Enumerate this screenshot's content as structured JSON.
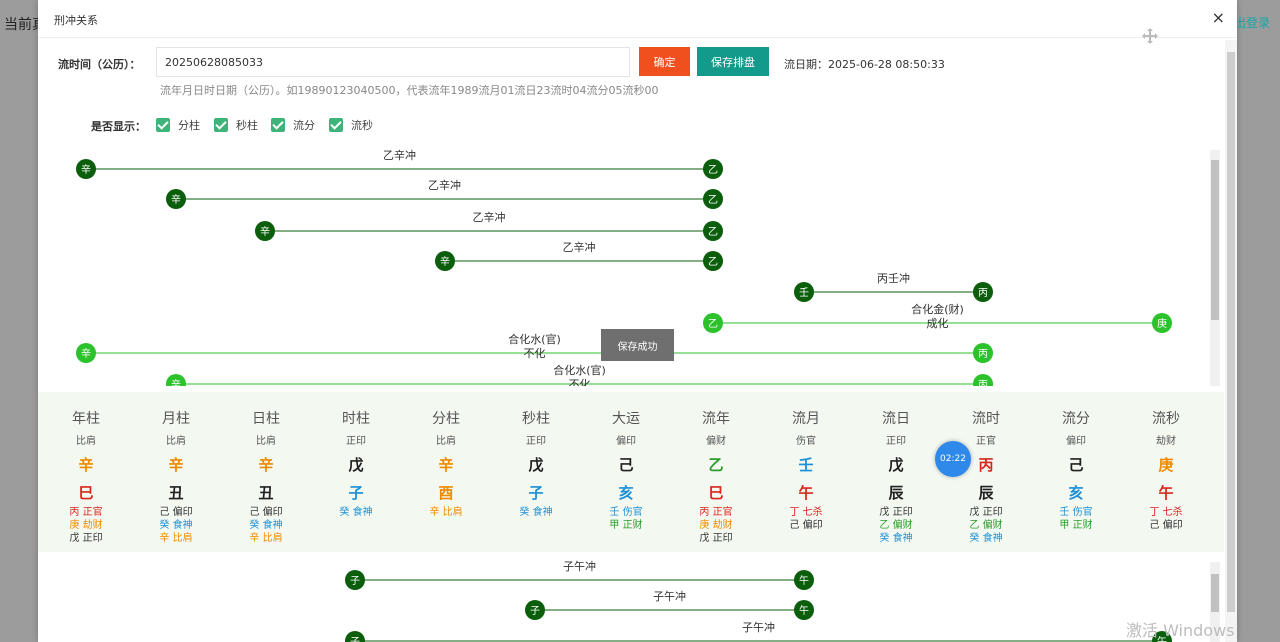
{
  "backdrop": {
    "left_text": "当前真",
    "right_text": "出登录"
  },
  "modal": {
    "title": "刑冲关系",
    "close": "×"
  },
  "form": {
    "liushi_label": "流时间（公历）：",
    "liushi_value": "20250628085033",
    "confirm_label": "确定",
    "save_label": "保存排盘",
    "liu_date": "流日期：2025-06-28 08:50:33",
    "hint": "流年月日时日期（公历）。如19890123040500，代表流年1989流月01流日23流时04流分05流秒00"
  },
  "display": {
    "label": "是否显示：",
    "options": [
      {
        "label": "分柱",
        "checked": true
      },
      {
        "label": "秒柱",
        "checked": true
      },
      {
        "label": "流分",
        "checked": true
      },
      {
        "label": "流秒",
        "checked": true
      }
    ]
  },
  "relations": [
    {
      "from": "辛",
      "to": "乙",
      "label": "乙辛冲",
      "color": "#0b5e0b"
    },
    {
      "from": "辛",
      "to": "乙",
      "label": "乙辛冲",
      "color": "#0b5e0b"
    },
    {
      "from": "辛",
      "to": "乙",
      "label": "乙辛冲",
      "color": "#0b5e0b"
    },
    {
      "from": "辛",
      "to": "乙",
      "label": "乙辛冲",
      "color": "#0b5e0b"
    },
    {
      "from": "壬",
      "to": "丙",
      "label": "丙壬冲",
      "color": "#0b5e0b"
    },
    {
      "from": "乙",
      "to": "庚",
      "label": "合化金(财)成化",
      "color": "#2bc22b"
    },
    {
      "from": "辛",
      "to": "丙",
      "label": "合化水(官)不化",
      "color": "#2bc22b"
    },
    {
      "from": "辛",
      "to": "丙",
      "label": "合化水(官)不化",
      "color": "#2bc22b"
    }
  ],
  "relations_bottom": [
    {
      "from": "子",
      "to": "午",
      "label": "子午冲",
      "color": "#0b5e0b"
    },
    {
      "from": "子",
      "to": "午",
      "label": "子午冲",
      "color": "#0b5e0b"
    },
    {
      "from": "子",
      "to": "午",
      "label": "子午冲",
      "color": "#0b5e0b"
    }
  ],
  "toast": "保存成功",
  "timer": "02:22",
  "pillars": [
    {
      "name": "年柱",
      "ten": "比肩",
      "stem": "辛",
      "stem_color": "#f08a00",
      "branch": "巳",
      "branch_color": "#d9261c",
      "hidden": [
        {
          "text": "丙  正官",
          "color": "#d9261c"
        },
        {
          "text": "庚  劫财",
          "color": "#f08a00"
        },
        {
          "text": "戊  正印",
          "color": "#333333"
        }
      ]
    },
    {
      "name": "月柱",
      "ten": "比肩",
      "stem": "辛",
      "stem_color": "#f08a00",
      "branch": "丑",
      "branch_color": "#222222",
      "hidden": [
        {
          "text": "己  偏印",
          "color": "#333333"
        },
        {
          "text": "癸  食神",
          "color": "#1e8fd6"
        },
        {
          "text": "辛  比肩",
          "color": "#f08a00"
        }
      ]
    },
    {
      "name": "日柱",
      "ten": "比肩",
      "stem": "辛",
      "stem_color": "#f08a00",
      "branch": "丑",
      "branch_color": "#222222",
      "hidden": [
        {
          "text": "己  偏印",
          "color": "#333333"
        },
        {
          "text": "癸  食神",
          "color": "#1e8fd6"
        },
        {
          "text": "辛  比肩",
          "color": "#f08a00"
        }
      ]
    },
    {
      "name": "时柱",
      "ten": "正印",
      "stem": "戊",
      "stem_color": "#222222",
      "branch": "子",
      "branch_color": "#1e8fd6",
      "hidden": [
        {
          "text": "癸  食神",
          "color": "#1e8fd6"
        }
      ]
    },
    {
      "name": "分柱",
      "ten": "比肩",
      "stem": "辛",
      "stem_color": "#f08a00",
      "branch": "酉",
      "branch_color": "#f08a00",
      "hidden": [
        {
          "text": "辛  比肩",
          "color": "#f08a00"
        }
      ]
    },
    {
      "name": "秒柱",
      "ten": "正印",
      "stem": "戊",
      "stem_color": "#222222",
      "branch": "子",
      "branch_color": "#1e8fd6",
      "hidden": [
        {
          "text": "癸  食神",
          "color": "#1e8fd6"
        }
      ]
    },
    {
      "name": "大运",
      "ten": "偏印",
      "stem": "己",
      "stem_color": "#222222",
      "branch": "亥",
      "branch_color": "#1e8fd6",
      "hidden": [
        {
          "text": "壬  伤官",
          "color": "#1e8fd6"
        },
        {
          "text": "甲  正财",
          "color": "#2c9c2c"
        }
      ]
    },
    {
      "name": "流年",
      "ten": "偏财",
      "stem": "乙",
      "stem_color": "#2c9c2c",
      "branch": "巳",
      "branch_color": "#d9261c",
      "hidden": [
        {
          "text": "丙  正官",
          "color": "#d9261c"
        },
        {
          "text": "庚  劫财",
          "color": "#f08a00"
        },
        {
          "text": "戊  正印",
          "color": "#333333"
        }
      ]
    },
    {
      "name": "流月",
      "ten": "伤官",
      "stem": "壬",
      "stem_color": "#1e8fd6",
      "branch": "午",
      "branch_color": "#d9261c",
      "hidden": [
        {
          "text": "丁  七杀",
          "color": "#d9261c"
        },
        {
          "text": "己  偏印",
          "color": "#333333"
        }
      ]
    },
    {
      "name": "流日",
      "ten": "正印",
      "stem": "戊",
      "stem_color": "#222222",
      "branch": "辰",
      "branch_color": "#222222",
      "hidden": [
        {
          "text": "戊  正印",
          "color": "#333333"
        },
        {
          "text": "乙  偏财",
          "color": "#2c9c2c"
        },
        {
          "text": "癸  食神",
          "color": "#1e8fd6"
        }
      ]
    },
    {
      "name": "流时",
      "ten": "正官",
      "stem": "丙",
      "stem_color": "#d9261c",
      "branch": "辰",
      "branch_color": "#222222",
      "hidden": [
        {
          "text": "戊  正印",
          "color": "#333333"
        },
        {
          "text": "乙  偏财",
          "color": "#2c9c2c"
        },
        {
          "text": "癸  食神",
          "color": "#1e8fd6"
        }
      ]
    },
    {
      "name": "流分",
      "ten": "偏印",
      "stem": "己",
      "stem_color": "#222222",
      "branch": "亥",
      "branch_color": "#1e8fd6",
      "hidden": [
        {
          "text": "壬  伤官",
          "color": "#1e8fd6"
        },
        {
          "text": "甲  正财",
          "color": "#2c9c2c"
        }
      ]
    },
    {
      "name": "流秒",
      "ten": "劫财",
      "stem": "庚",
      "stem_color": "#f08a00",
      "branch": "午",
      "branch_color": "#d9261c",
      "hidden": [
        {
          "text": "丁  七杀",
          "color": "#d9261c"
        },
        {
          "text": "己  偏印",
          "color": "#333333"
        }
      ]
    }
  ],
  "watermark": "激活 Windows"
}
